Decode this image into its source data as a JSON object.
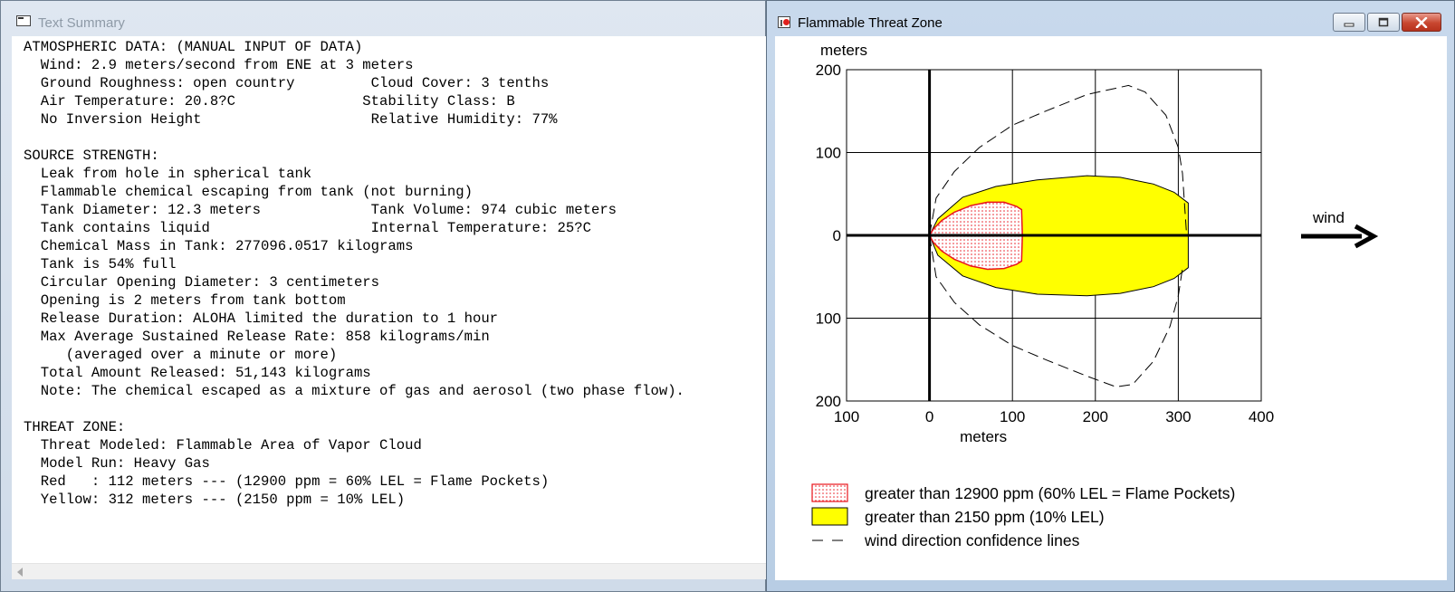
{
  "left_window": {
    "title": "Text Summary",
    "summary_lines": [
      "ATMOSPHERIC DATA: (MANUAL INPUT OF DATA)",
      "  Wind: 2.9 meters/second from ENE at 3 meters",
      "  Ground Roughness: open country         Cloud Cover: 3 tenths",
      "  Air Temperature: 20.8?C               Stability Class: B",
      "  No Inversion Height                    Relative Humidity: 77%",
      "",
      "SOURCE STRENGTH:",
      "  Leak from hole in spherical tank",
      "  Flammable chemical escaping from tank (not burning)",
      "  Tank Diameter: 12.3 meters             Tank Volume: 974 cubic meters",
      "  Tank contains liquid                   Internal Temperature: 25?C",
      "  Chemical Mass in Tank: 277096.0517 kilograms",
      "  Tank is 54% full",
      "  Circular Opening Diameter: 3 centimeters",
      "  Opening is 2 meters from tank bottom",
      "  Release Duration: ALOHA limited the duration to 1 hour",
      "  Max Average Sustained Release Rate: 858 kilograms/min",
      "     (averaged over a minute or more)",
      "  Total Amount Released: 51,143 kilograms",
      "  Note: The chemical escaped as a mixture of gas and aerosol (two phase flow).",
      "",
      "THREAT ZONE:",
      "  Threat Modeled: Flammable Area of Vapor Cloud",
      "  Model Run: Heavy Gas",
      "  Red   : 112 meters --- (12900 ppm = 60% LEL = Flame Pockets)",
      "  Yellow: 312 meters --- (2150 ppm = 10% LEL)"
    ]
  },
  "right_window": {
    "title": "Flammable Threat Zone",
    "buttons": {
      "minimize": "minimize-icon",
      "maximize": "maximize-icon",
      "close": "close-icon"
    }
  },
  "chart_data": {
    "type": "area",
    "y_axis_title": "meters",
    "x_axis_title": "meters",
    "x_tick_labels": [
      "100",
      "0",
      "100",
      "200",
      "300",
      "400"
    ],
    "x_tick_values": [
      -100,
      0,
      100,
      200,
      300,
      400
    ],
    "y_tick_labels": [
      "200",
      "100",
      "0",
      "100",
      "200"
    ],
    "y_tick_values": [
      200,
      100,
      0,
      -100,
      -200
    ],
    "xlim": [
      -100,
      400
    ],
    "ylim": [
      -200,
      200
    ],
    "grid": true,
    "wind_label": "wind",
    "wind_direction": "right",
    "zones": [
      {
        "name": "red",
        "color": "#ff0000",
        "fill": "red-dotted",
        "boundary": [
          [
            0,
            0
          ],
          [
            5,
            8
          ],
          [
            15,
            18
          ],
          [
            30,
            28
          ],
          [
            50,
            36
          ],
          [
            70,
            40
          ],
          [
            90,
            40
          ],
          [
            105,
            35
          ],
          [
            111,
            31
          ],
          [
            112,
            0
          ],
          [
            111,
            -31
          ],
          [
            105,
            -35
          ],
          [
            90,
            -40
          ],
          [
            70,
            -41
          ],
          [
            50,
            -37
          ],
          [
            30,
            -29
          ],
          [
            15,
            -19
          ],
          [
            5,
            -9
          ],
          [
            0,
            0
          ]
        ]
      },
      {
        "name": "yellow",
        "color": "#ffff00",
        "fill": "solid",
        "boundary": [
          [
            0,
            0
          ],
          [
            10,
            20
          ],
          [
            40,
            46
          ],
          [
            80,
            59
          ],
          [
            130,
            67
          ],
          [
            190,
            72
          ],
          [
            230,
            70
          ],
          [
            270,
            62
          ],
          [
            295,
            52
          ],
          [
            312,
            39
          ],
          [
            312,
            -39
          ],
          [
            295,
            -52
          ],
          [
            270,
            -62
          ],
          [
            230,
            -70
          ],
          [
            190,
            -73
          ],
          [
            130,
            -71
          ],
          [
            80,
            -63
          ],
          [
            40,
            -49
          ],
          [
            10,
            -24
          ],
          [
            0,
            0
          ]
        ]
      }
    ],
    "confidence_lines": [
      {
        "name": "upper",
        "points": [
          [
            0,
            0
          ],
          [
            8,
            45
          ],
          [
            30,
            77
          ],
          [
            60,
            106
          ],
          [
            100,
            133
          ],
          [
            140,
            150
          ],
          [
            190,
            170
          ],
          [
            240,
            181
          ],
          [
            260,
            173
          ],
          [
            285,
            145
          ],
          [
            300,
            106
          ],
          [
            305,
            75
          ],
          [
            310,
            0
          ]
        ]
      },
      {
        "name": "lower",
        "points": [
          [
            0,
            0
          ],
          [
            8,
            -50
          ],
          [
            30,
            -81
          ],
          [
            60,
            -108
          ],
          [
            100,
            -133
          ],
          [
            140,
            -150
          ],
          [
            190,
            -170
          ],
          [
            225,
            -183
          ],
          [
            245,
            -180
          ],
          [
            270,
            -152
          ],
          [
            290,
            -110
          ],
          [
            300,
            -73
          ],
          [
            305,
            -40
          ]
        ]
      }
    ],
    "legend": [
      {
        "label": "greater than 12900 ppm (60% LEL = Flame Pockets)",
        "swatch": "red-dotted"
      },
      {
        "label": "greater than 2150 ppm (10% LEL)",
        "swatch": "yellow"
      },
      {
        "label": "wind direction confidence lines",
        "swatch": "dashed"
      }
    ]
  }
}
